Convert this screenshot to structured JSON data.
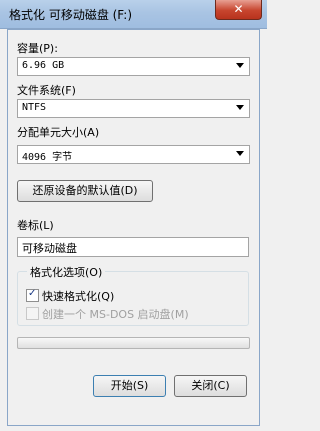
{
  "window": {
    "title": "格式化 可移动磁盘 (F:)",
    "close_glyph": "✕"
  },
  "capacity": {
    "label": "容量(P):",
    "value": "6.96 GB"
  },
  "filesystem": {
    "label": "文件系统(F)",
    "value": "NTFS"
  },
  "allocation": {
    "label": "分配单元大小(A)",
    "value": "4096 字节"
  },
  "restore_defaults_label": "还原设备的默认值(D)",
  "volume": {
    "label": "卷标(L)",
    "value": "可移动磁盘"
  },
  "options": {
    "legend": "格式化选项(O)",
    "quick_format": {
      "label": "快速格式化(Q)",
      "checked": true
    },
    "msdos_boot": {
      "label": "创建一个 MS-DOS 启动盘(M)",
      "checked": false,
      "enabled": false
    }
  },
  "progress": {
    "value": 0
  },
  "buttons": {
    "start": "开始(S)",
    "close": "关闭(C)"
  }
}
